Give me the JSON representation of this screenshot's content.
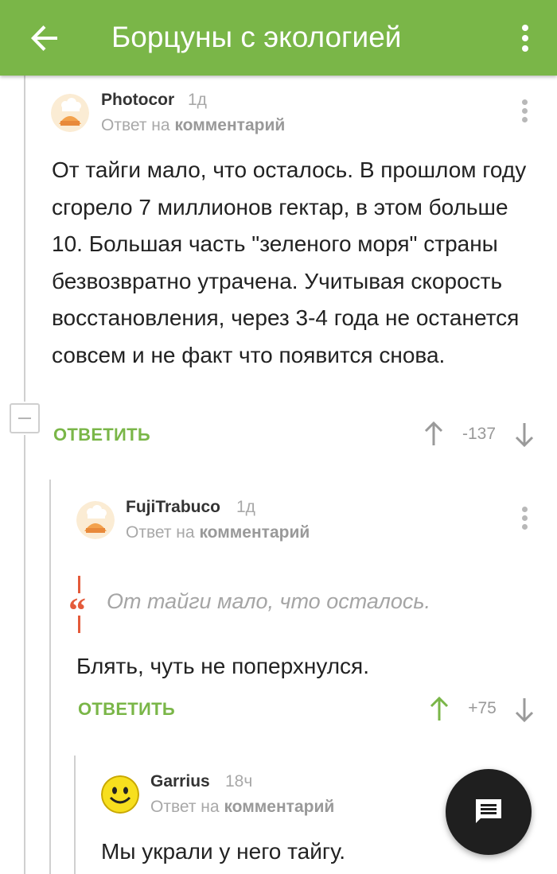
{
  "appbar": {
    "title": "Борцуны с экологией",
    "back_icon": "arrow-left-icon",
    "menu_icon": "more-vertical-icon"
  },
  "comments": [
    {
      "username": "Photocor",
      "time": "1д",
      "reply_prefix": "Ответ на",
      "reply_target": "комментарий",
      "text": "От тайги мало, что осталось. В прошлом году сгорело 7 миллионов гектар, в этом больше 10. Большая часть \"зеленого моря\" страны безвозвратно утрачена. Учитывая скорость восстановления, через 3-4 года не останется совсем и не факт что появится снова.",
      "reply_label": "ОТВЕТИТЬ",
      "rating": "-137"
    },
    {
      "username": "FujiTrabuco",
      "time": "1д",
      "reply_prefix": "Ответ на",
      "reply_target": "комментарий",
      "quote": "От тайги мало, что осталось.",
      "text": "Блять, чуть не поперхнулся.",
      "reply_label": "ОТВЕТИТЬ",
      "rating": "+75"
    },
    {
      "username": "Garrius",
      "time": "18ч",
      "reply_prefix": "Ответ на",
      "reply_target": "комментарий",
      "text": "Мы украли у него тайгу."
    }
  ],
  "colors": {
    "accent": "#7ab648",
    "quote": "#e45b3b",
    "fab": "#1f1f1f"
  },
  "fab_icon": "message-icon"
}
